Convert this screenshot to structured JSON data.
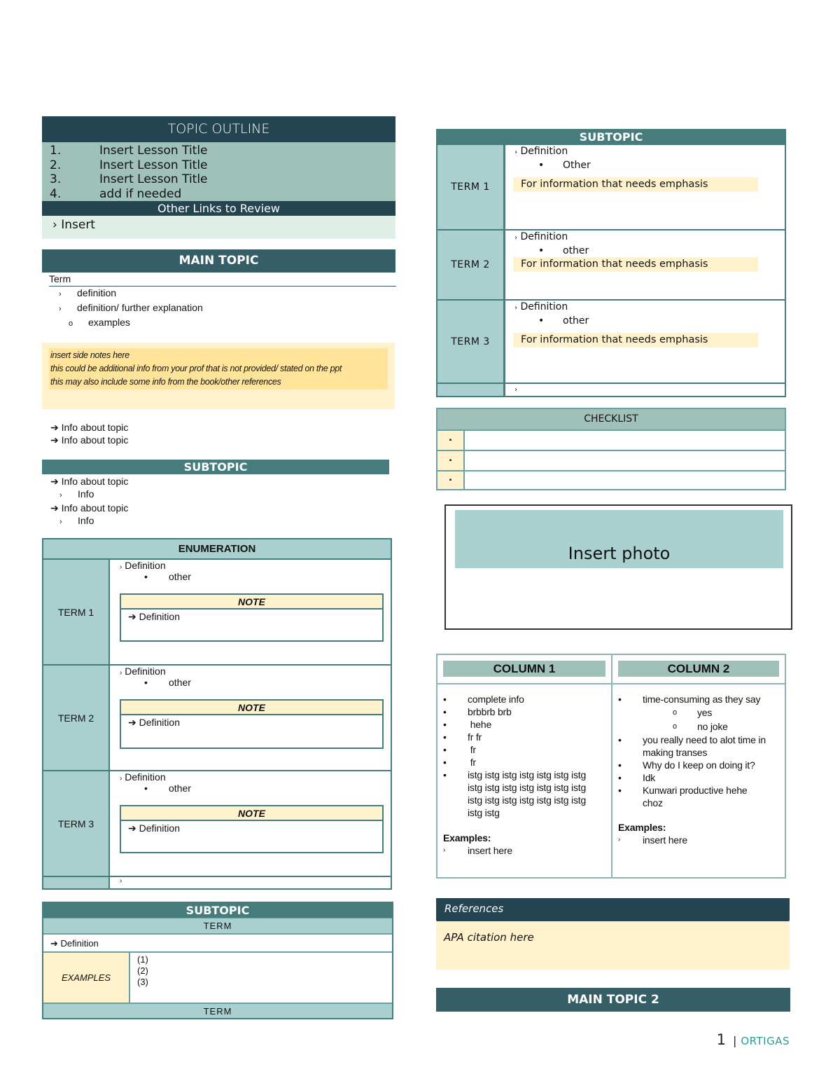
{
  "colors": {
    "dark_header": "#234450",
    "main_topic": "#355e66",
    "subtopic": "#467c7c",
    "term_cell": "#a9cfcf",
    "outline_list": "#a0c1ba",
    "links_bg": "#e0efe6",
    "note_yellow": "#fff2cc",
    "sidenote_inner": "#ffe49a",
    "brand": "#2e9e94"
  },
  "outline": {
    "title": "TOPIC OUTLINE",
    "items": [
      {
        "num": "1.",
        "label": "Insert Lesson Title"
      },
      {
        "num": "2.",
        "label": "Insert Lesson Title"
      },
      {
        "num": "3.",
        "label": "Insert Lesson Title"
      },
      {
        "num": "4.",
        "label": "add if needed"
      }
    ],
    "links_title": "Other Links to Review",
    "links": [
      {
        "bullet": "›",
        "label": "Insert"
      }
    ]
  },
  "main_topic": {
    "title": "MAIN TOPIC",
    "term": "Term",
    "bullets": [
      {
        "bullet": "›",
        "text": "definition"
      },
      {
        "bullet": "›",
        "text": "definition/ further explanation"
      }
    ],
    "sub_bullets": [
      {
        "bullet": "o",
        "text": "examples"
      }
    ]
  },
  "side_notes": [
    "insert side notes here",
    "this could be additional info from your prof that is not provided/ stated on the ppt",
    "this may also include some info from the book/other references"
  ],
  "info_lines": [
    "Info about topic",
    "Info about topic"
  ],
  "subtopic1": {
    "title": "SUBTOPIC",
    "items": [
      {
        "text": "Info about topic",
        "sub": "Info"
      },
      {
        "text": "Info about topic",
        "sub": "Info"
      }
    ]
  },
  "enumeration": {
    "title": "ENUMERATION",
    "rows": [
      {
        "term": "TERM 1",
        "definition": "Definition",
        "other": "other",
        "note_title": "NOTE",
        "note_body": "Definition"
      },
      {
        "term": "TERM 2",
        "definition": "Definition",
        "other": "other",
        "note_title": "NOTE",
        "note_body": "Definition"
      },
      {
        "term": "TERM 3",
        "definition": "Definition",
        "other": "other",
        "note_title": "NOTE",
        "note_body": "Definition"
      }
    ],
    "last_bullet": "›"
  },
  "subtopic2": {
    "title": "SUBTOPIC",
    "term_top": "TERM",
    "definition": "Definition",
    "examples_label": "EXAMPLES",
    "examples": [
      "(1)",
      "(2)",
      "(3)"
    ],
    "term_bottom": "TERM"
  },
  "right_subtopic": {
    "title": "SUBTOPIC",
    "rows": [
      {
        "term": "TERM 1",
        "definition": "Definition",
        "other": "Other",
        "emphasis": "For information that needs emphasis"
      },
      {
        "term": "TERM 2",
        "definition": "Definition",
        "other": "other",
        "emphasis": "For information that needs emphasis"
      },
      {
        "term": "TERM 3",
        "definition": "Definition",
        "other": "other",
        "emphasis": "For information that needs emphasis"
      }
    ],
    "last_bullet": "›"
  },
  "checklist": {
    "title": "CHECKLIST",
    "items": [
      {
        "box": "▪",
        "text": ""
      },
      {
        "box": "▪",
        "text": ""
      },
      {
        "box": "▪",
        "text": ""
      }
    ]
  },
  "photo": {
    "label": "Insert photo"
  },
  "columns": [
    {
      "title": "COLUMN 1",
      "items": [
        {
          "level": 1,
          "text": "complete info"
        },
        {
          "level": 1,
          "text": "brbbrb brb"
        },
        {
          "level": 1,
          "text": " hehe"
        },
        {
          "level": 1,
          "text": "fr fr"
        },
        {
          "level": 1,
          "text": " fr"
        },
        {
          "level": 1,
          "text": " fr"
        },
        {
          "level": 1,
          "text": "istg istg istg istg istg istg istg istg istg istg istg istg istg istg istg istg istg istg istg istg istg istg istg"
        }
      ],
      "examples_label": "Examples:",
      "examples": [
        "insert here"
      ]
    },
    {
      "title": "COLUMN 2",
      "items": [
        {
          "level": 1,
          "text": "time-consuming as they say"
        },
        {
          "level": 2,
          "text": "yes"
        },
        {
          "level": 2,
          "text": "no joke"
        },
        {
          "level": 1,
          "text": "you really need to alot time in making transes"
        },
        {
          "level": 1,
          "text": "Why do I keep on doing it?"
        },
        {
          "level": 1,
          "text": "Idk"
        },
        {
          "level": 1,
          "text": "Kunwari productive hehe choz"
        }
      ],
      "examples_label": "Examples:",
      "examples": [
        "insert here"
      ]
    }
  ],
  "references": {
    "title": "References",
    "body": "APA citation here"
  },
  "main_topic2": {
    "title": "MAIN TOPIC 2"
  },
  "footer": {
    "page": "1",
    "separator": "|",
    "brand": "ORTIGAS"
  }
}
